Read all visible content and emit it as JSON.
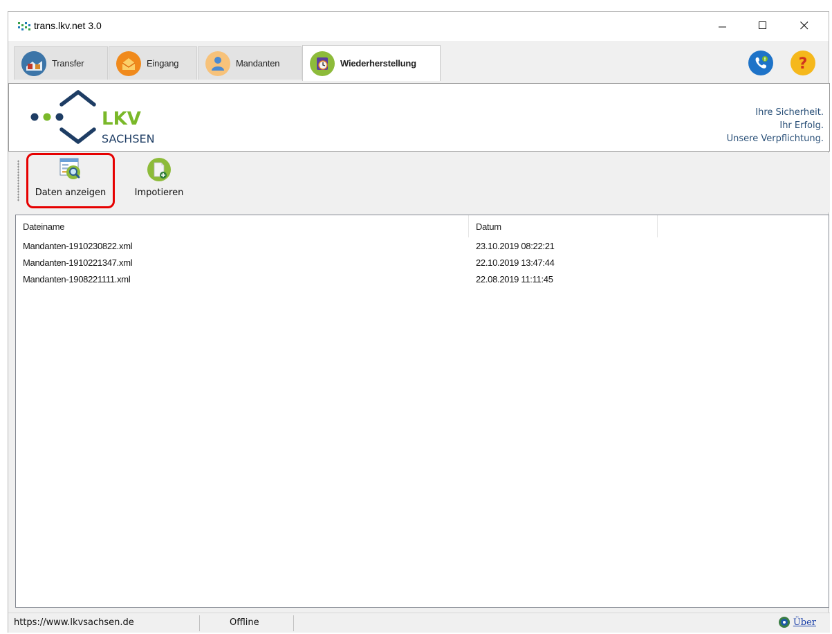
{
  "window": {
    "title": "trans.lkv.net 3.0",
    "icon": "app-logo-icon",
    "controls": [
      "minimize-icon",
      "maximize-icon",
      "close-icon"
    ]
  },
  "tabs": [
    {
      "label": "Transfer",
      "icon": "transfer-icon",
      "active": false
    },
    {
      "label": "Eingang",
      "icon": "inbox-icon",
      "active": false
    },
    {
      "label": "Mandanten",
      "icon": "client-person-icon",
      "active": false
    },
    {
      "label": "Wiederherstellung",
      "icon": "restore-clock-icon",
      "active": true
    }
  ],
  "header_buttons": [
    "support-phone-icon",
    "help-question-icon"
  ],
  "banner": {
    "logo_text_1": "LKV",
    "logo_text_2": "SACHSEN",
    "slogan": [
      "Ihre Sicherheit.",
      "Ihr Erfolg.",
      "Unsere Verpflichtung."
    ]
  },
  "toolbar": {
    "view_label": "Daten anzeigen",
    "import_label": "Impotieren"
  },
  "table": {
    "columns": [
      "Dateiname",
      "Datum"
    ],
    "rows": [
      {
        "name": "Mandanten-1910230822.xml",
        "date": "23.10.2019 08:22:21"
      },
      {
        "name": "Mandanten-1910221347.xml",
        "date": "22.10.2019 13:47:44"
      },
      {
        "name": "Mandanten-1908221111.xml",
        "date": "22.08.2019 11:11:45"
      }
    ]
  },
  "status": {
    "url": "https://www.lkvsachsen.de",
    "connection": "Offline",
    "about_label": "Über"
  },
  "colors": {
    "logo_green": "#7ab829",
    "logo_blue": "#1e3d64",
    "slogan_blue": "#2a5078",
    "highlight_red": "#e60000",
    "link_blue": "#1a3fa8"
  }
}
